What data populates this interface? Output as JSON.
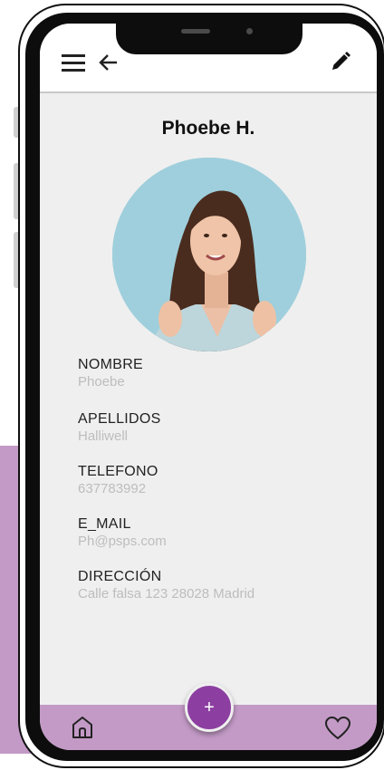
{
  "app_bar": {
    "menu_icon": "hamburger-menu-icon",
    "back_icon": "arrow-left-icon",
    "edit_icon": "pencil-icon"
  },
  "profile": {
    "display_name": "Phoebe H.",
    "avatar": "profile-photo"
  },
  "fields": [
    {
      "label": "NOMBRE",
      "value": "Phoebe"
    },
    {
      "label": "APELLIDOS",
      "value": "Halliwell"
    },
    {
      "label": "TELEFONO",
      "value": "637783992"
    },
    {
      "label": "E_MAIL",
      "value": "Ph@psps.com"
    },
    {
      "label": "DIRECCIÓN",
      "value": "Calle falsa 123 28028 Madrid"
    }
  ],
  "bottom_nav": {
    "home_icon": "home-icon",
    "add_label": "+",
    "favorite_icon": "heart-icon"
  },
  "colors": {
    "accent": "#8c3fa1",
    "nav_background": "#c39ac6",
    "screen_background": "#efefef",
    "value_text": "#bdbdbd"
  }
}
